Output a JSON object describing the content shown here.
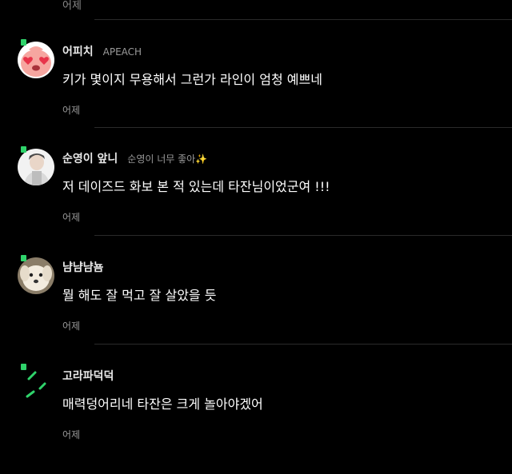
{
  "top": {
    "time": "어제"
  },
  "comments": [
    {
      "name": "어피치",
      "tag": "APEACH",
      "text": "키가 몇이지 무용해서 그런가 라인이 엄청 예쁘네",
      "time": "어제"
    },
    {
      "name": "순영이 앞니",
      "tag": "순영이 너무 좋아✨",
      "text": "저 데이즈드 화보 본 적 있는데 타잔님이었군여 !!!",
      "time": "어제"
    },
    {
      "name": "냠냠냠뇸",
      "tag": "",
      "text": "뭘 해도 잘 먹고 잘 살았을 듯",
      "time": "어제"
    },
    {
      "name": "고라파덕덕",
      "tag": "",
      "text": "매력덩어리네 타잔은 크게 놀아야겠어",
      "time": "어제"
    }
  ],
  "colors": {
    "background": "#000000",
    "badge": "#2fd36b",
    "divider": "#2a2a2a",
    "meta_text": "#9a9a9a",
    "apeach_pink": "#f6a6a0",
    "heart_red": "#e8344a"
  },
  "icons": {
    "avatar_1": "apeach-heart-eyes-icon",
    "avatar_2": "person-photo-icon",
    "avatar_3": "dog-photo-icon",
    "avatar_4": "green-sparkle-icon"
  }
}
